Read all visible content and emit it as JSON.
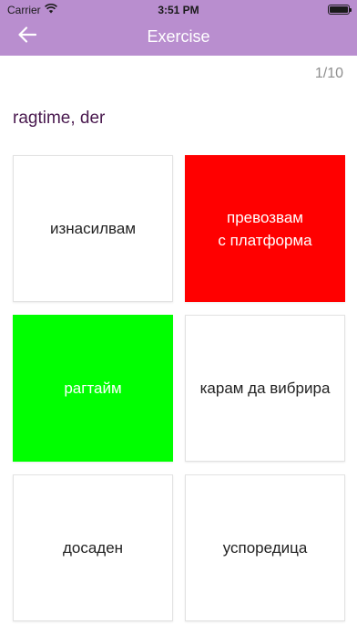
{
  "status_bar": {
    "carrier": "Carrier",
    "time": "3:51 PM",
    "wifi_icon": "wifi-icon",
    "battery_icon": "battery-icon",
    "battery_level": 1.0
  },
  "nav": {
    "title": "Exercise",
    "back_icon": "arrow-left-icon",
    "background": "#b98ecf"
  },
  "progress": {
    "label": "1/10"
  },
  "question": {
    "word": "ragtime, der"
  },
  "options": [
    {
      "label": "изнасилвам",
      "state": "neutral",
      "color": "#ffffff"
    },
    {
      "label": "превозвам\nс платформа",
      "state": "wrong",
      "color": "#ff0000"
    },
    {
      "label": "рагтайм",
      "state": "correct",
      "color": "#00ff00"
    },
    {
      "label": "карам да вибрира",
      "state": "neutral",
      "color": "#ffffff"
    },
    {
      "label": "досаден",
      "state": "neutral",
      "color": "#ffffff"
    },
    {
      "label": "успоредица",
      "state": "neutral",
      "color": "#ffffff"
    }
  ]
}
